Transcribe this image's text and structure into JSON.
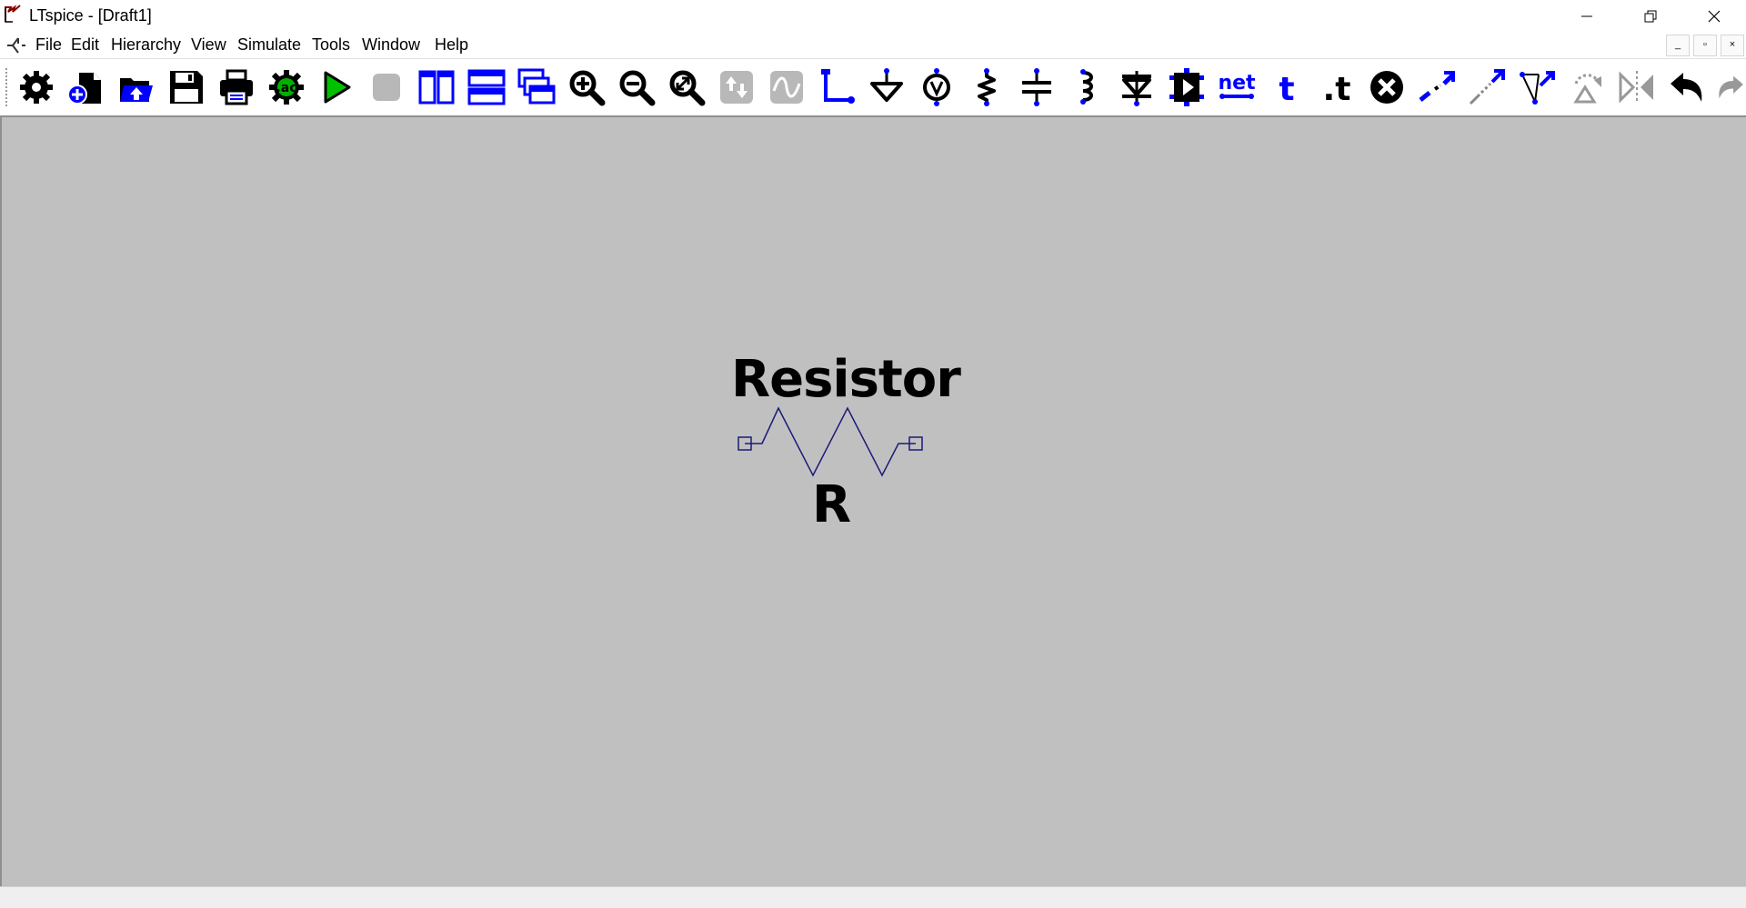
{
  "window": {
    "title": "LTspice - [Draft1]",
    "controls": {
      "minimize": "—",
      "restore": "❐",
      "close": "✕"
    }
  },
  "menu": {
    "items": [
      {
        "label": "File"
      },
      {
        "label": "Edit"
      },
      {
        "label": "Hierarchy"
      },
      {
        "label": "View"
      },
      {
        "label": "Simulate"
      },
      {
        "label": "Tools"
      },
      {
        "label": "Window"
      },
      {
        "label": "Help"
      }
    ],
    "mdi_controls": {
      "minimize": "_",
      "restore": "▫",
      "close": "×"
    }
  },
  "toolbar": {
    "items": [
      {
        "icon": "gear-icon"
      },
      {
        "icon": "new-schematic-icon"
      },
      {
        "icon": "open-icon"
      },
      {
        "icon": "save-icon"
      },
      {
        "icon": "print-icon"
      },
      {
        "icon": "ac-analysis-icon",
        "text": ".ac"
      },
      {
        "icon": "run-icon"
      },
      {
        "icon": "halt-icon"
      },
      {
        "icon": "tile-vertical-icon"
      },
      {
        "icon": "tile-horizontal-icon"
      },
      {
        "icon": "cascade-icon"
      },
      {
        "icon": "zoom-in-icon"
      },
      {
        "icon": "zoom-out-icon"
      },
      {
        "icon": "zoom-fit-icon"
      },
      {
        "icon": "pan-icon"
      },
      {
        "icon": "waveform-icon"
      },
      {
        "icon": "wire-icon"
      },
      {
        "icon": "ground-icon"
      },
      {
        "icon": "voltage-source-icon"
      },
      {
        "icon": "resistor-icon"
      },
      {
        "icon": "capacitor-icon"
      },
      {
        "icon": "inductor-icon"
      },
      {
        "icon": "diode-icon"
      },
      {
        "icon": "component-icon"
      },
      {
        "icon": "net-label-icon",
        "text": "net"
      },
      {
        "icon": "text-icon",
        "text": "t"
      },
      {
        "icon": "spice-directive-icon",
        "text": ".t"
      },
      {
        "icon": "delete-icon"
      },
      {
        "icon": "duplicate-icon"
      },
      {
        "icon": "move-icon"
      },
      {
        "icon": "drag-icon"
      },
      {
        "icon": "rotate-icon"
      },
      {
        "icon": "mirror-icon"
      },
      {
        "icon": "undo-icon"
      },
      {
        "icon": "redo-icon"
      }
    ]
  },
  "schematic": {
    "component_name": "Resistor",
    "component_ref": "R"
  },
  "colors": {
    "canvas": "#c0c0c0",
    "symbol": "#1a1a7a",
    "icon_blue": "#0000ff",
    "icon_black": "#000000",
    "run_green": "#00c000",
    "disabled_gray": "#b8b8b8"
  }
}
